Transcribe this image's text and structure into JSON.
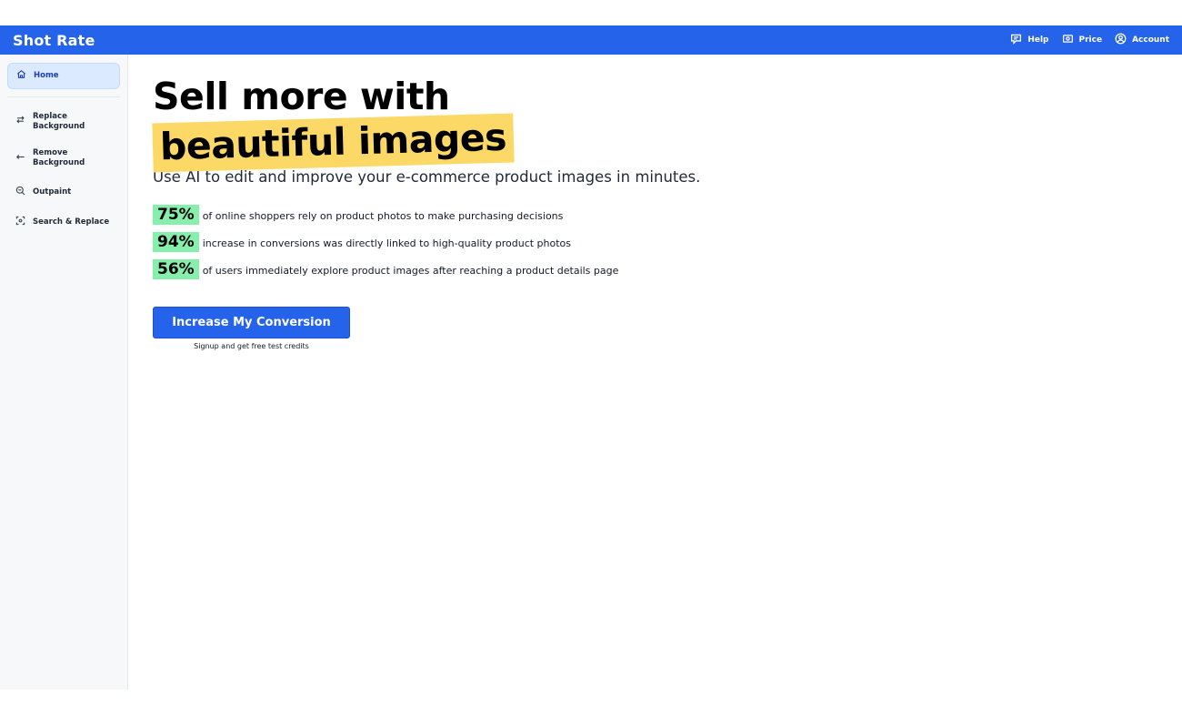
{
  "app": {
    "title": "Shot Rate"
  },
  "nav": {
    "help": "Help",
    "price": "Price",
    "account": "Account"
  },
  "sidebar": {
    "items": [
      {
        "label": "Home",
        "icon": "home-icon"
      },
      {
        "label": "Replace Background",
        "icon": "swap-arrows-icon"
      },
      {
        "label": "Remove Background",
        "icon": "arrow-left-icon"
      },
      {
        "label": "Outpaint",
        "icon": "zoom-out-icon"
      },
      {
        "label": "Search & Replace",
        "icon": "focus-scan-icon"
      }
    ]
  },
  "hero": {
    "title_line1": "Sell more with",
    "title_highlight": "beautiful images",
    "subtitle": "Use AI to edit and improve your e-commerce product images in minutes."
  },
  "stats": [
    {
      "value": "75%",
      "text": "of online shoppers rely on product photos to make purchasing decisions"
    },
    {
      "value": "94%",
      "text": "increase in conversions was directly linked to high-quality product photos"
    },
    {
      "value": "56%",
      "text": "of users immediately explore product images after reaching a product details page"
    }
  ],
  "cta": {
    "button_label": "Increase My Conversion",
    "note": "Signup and get free test credits"
  },
  "colors": {
    "brand": "#2563eb",
    "highlight": "#fcd967",
    "stat_badge": "#86efac"
  }
}
